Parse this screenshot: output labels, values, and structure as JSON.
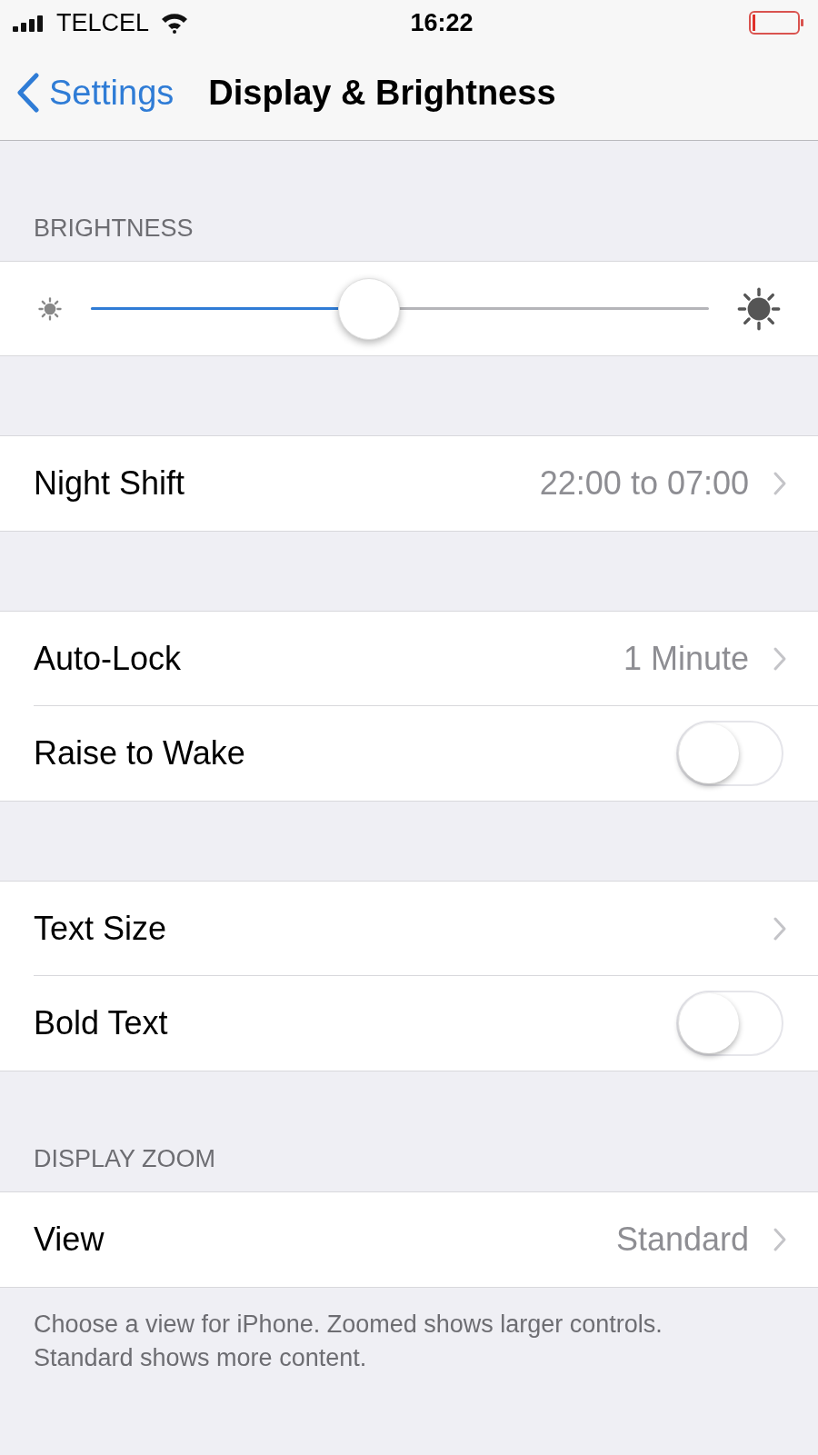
{
  "status_bar": {
    "carrier": "TELCEL",
    "time": "16:22"
  },
  "nav": {
    "back": "Settings",
    "title": "Display & Brightness"
  },
  "groups": [
    {
      "header": "BRIGHTNESS",
      "rows": [
        {
          "kind": "slider",
          "level": 0.45
        }
      ]
    },
    {
      "rows": [
        {
          "kind": "disclosure",
          "label": "Night Shift",
          "value": "22:00 to 07:00"
        }
      ]
    },
    {
      "rows": [
        {
          "kind": "disclosure",
          "label": "Auto-Lock",
          "value": "1 Minute"
        },
        {
          "kind": "switch",
          "label": "Raise to Wake",
          "on": false
        }
      ]
    },
    {
      "rows": [
        {
          "kind": "disclosure",
          "label": "Text Size"
        },
        {
          "kind": "switch",
          "label": "Bold Text",
          "on": false
        }
      ]
    },
    {
      "header": "DISPLAY ZOOM",
      "rows": [
        {
          "kind": "disclosure",
          "label": "View",
          "value": "Standard"
        }
      ],
      "footer": "Choose a view for iPhone. Zoomed shows larger controls. Standard shows more content."
    }
  ]
}
